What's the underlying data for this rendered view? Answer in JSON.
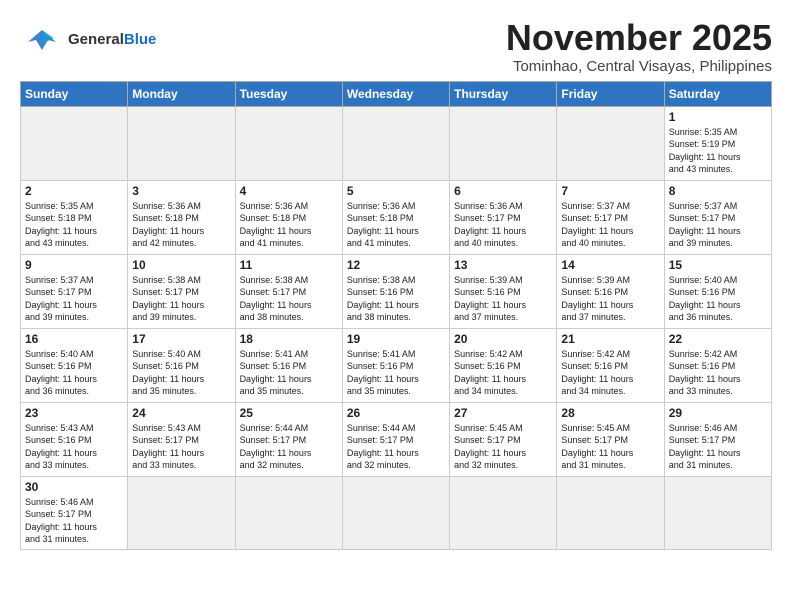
{
  "header": {
    "logo_general": "General",
    "logo_blue": "Blue",
    "month_title": "November 2025",
    "location": "Tominhao, Central Visayas, Philippines"
  },
  "weekdays": [
    "Sunday",
    "Monday",
    "Tuesday",
    "Wednesday",
    "Thursday",
    "Friday",
    "Saturday"
  ],
  "weeks": [
    [
      {
        "day": "",
        "info": ""
      },
      {
        "day": "",
        "info": ""
      },
      {
        "day": "",
        "info": ""
      },
      {
        "day": "",
        "info": ""
      },
      {
        "day": "",
        "info": ""
      },
      {
        "day": "",
        "info": ""
      },
      {
        "day": "1",
        "info": "Sunrise: 5:35 AM\nSunset: 5:19 PM\nDaylight: 11 hours\nand 43 minutes."
      }
    ],
    [
      {
        "day": "2",
        "info": "Sunrise: 5:35 AM\nSunset: 5:18 PM\nDaylight: 11 hours\nand 43 minutes."
      },
      {
        "day": "3",
        "info": "Sunrise: 5:36 AM\nSunset: 5:18 PM\nDaylight: 11 hours\nand 42 minutes."
      },
      {
        "day": "4",
        "info": "Sunrise: 5:36 AM\nSunset: 5:18 PM\nDaylight: 11 hours\nand 41 minutes."
      },
      {
        "day": "5",
        "info": "Sunrise: 5:36 AM\nSunset: 5:18 PM\nDaylight: 11 hours\nand 41 minutes."
      },
      {
        "day": "6",
        "info": "Sunrise: 5:36 AM\nSunset: 5:17 PM\nDaylight: 11 hours\nand 40 minutes."
      },
      {
        "day": "7",
        "info": "Sunrise: 5:37 AM\nSunset: 5:17 PM\nDaylight: 11 hours\nand 40 minutes."
      },
      {
        "day": "8",
        "info": "Sunrise: 5:37 AM\nSunset: 5:17 PM\nDaylight: 11 hours\nand 39 minutes."
      }
    ],
    [
      {
        "day": "9",
        "info": "Sunrise: 5:37 AM\nSunset: 5:17 PM\nDaylight: 11 hours\nand 39 minutes."
      },
      {
        "day": "10",
        "info": "Sunrise: 5:38 AM\nSunset: 5:17 PM\nDaylight: 11 hours\nand 39 minutes."
      },
      {
        "day": "11",
        "info": "Sunrise: 5:38 AM\nSunset: 5:17 PM\nDaylight: 11 hours\nand 38 minutes."
      },
      {
        "day": "12",
        "info": "Sunrise: 5:38 AM\nSunset: 5:16 PM\nDaylight: 11 hours\nand 38 minutes."
      },
      {
        "day": "13",
        "info": "Sunrise: 5:39 AM\nSunset: 5:16 PM\nDaylight: 11 hours\nand 37 minutes."
      },
      {
        "day": "14",
        "info": "Sunrise: 5:39 AM\nSunset: 5:16 PM\nDaylight: 11 hours\nand 37 minutes."
      },
      {
        "day": "15",
        "info": "Sunrise: 5:40 AM\nSunset: 5:16 PM\nDaylight: 11 hours\nand 36 minutes."
      }
    ],
    [
      {
        "day": "16",
        "info": "Sunrise: 5:40 AM\nSunset: 5:16 PM\nDaylight: 11 hours\nand 36 minutes."
      },
      {
        "day": "17",
        "info": "Sunrise: 5:40 AM\nSunset: 5:16 PM\nDaylight: 11 hours\nand 35 minutes."
      },
      {
        "day": "18",
        "info": "Sunrise: 5:41 AM\nSunset: 5:16 PM\nDaylight: 11 hours\nand 35 minutes."
      },
      {
        "day": "19",
        "info": "Sunrise: 5:41 AM\nSunset: 5:16 PM\nDaylight: 11 hours\nand 35 minutes."
      },
      {
        "day": "20",
        "info": "Sunrise: 5:42 AM\nSunset: 5:16 PM\nDaylight: 11 hours\nand 34 minutes."
      },
      {
        "day": "21",
        "info": "Sunrise: 5:42 AM\nSunset: 5:16 PM\nDaylight: 11 hours\nand 34 minutes."
      },
      {
        "day": "22",
        "info": "Sunrise: 5:42 AM\nSunset: 5:16 PM\nDaylight: 11 hours\nand 33 minutes."
      }
    ],
    [
      {
        "day": "23",
        "info": "Sunrise: 5:43 AM\nSunset: 5:16 PM\nDaylight: 11 hours\nand 33 minutes."
      },
      {
        "day": "24",
        "info": "Sunrise: 5:43 AM\nSunset: 5:17 PM\nDaylight: 11 hours\nand 33 minutes."
      },
      {
        "day": "25",
        "info": "Sunrise: 5:44 AM\nSunset: 5:17 PM\nDaylight: 11 hours\nand 32 minutes."
      },
      {
        "day": "26",
        "info": "Sunrise: 5:44 AM\nSunset: 5:17 PM\nDaylight: 11 hours\nand 32 minutes."
      },
      {
        "day": "27",
        "info": "Sunrise: 5:45 AM\nSunset: 5:17 PM\nDaylight: 11 hours\nand 32 minutes."
      },
      {
        "day": "28",
        "info": "Sunrise: 5:45 AM\nSunset: 5:17 PM\nDaylight: 11 hours\nand 31 minutes."
      },
      {
        "day": "29",
        "info": "Sunrise: 5:46 AM\nSunset: 5:17 PM\nDaylight: 11 hours\nand 31 minutes."
      }
    ],
    [
      {
        "day": "30",
        "info": "Sunrise: 5:46 AM\nSunset: 5:17 PM\nDaylight: 11 hours\nand 31 minutes."
      },
      {
        "day": "",
        "info": ""
      },
      {
        "day": "",
        "info": ""
      },
      {
        "day": "",
        "info": ""
      },
      {
        "day": "",
        "info": ""
      },
      {
        "day": "",
        "info": ""
      },
      {
        "day": "",
        "info": ""
      }
    ]
  ]
}
